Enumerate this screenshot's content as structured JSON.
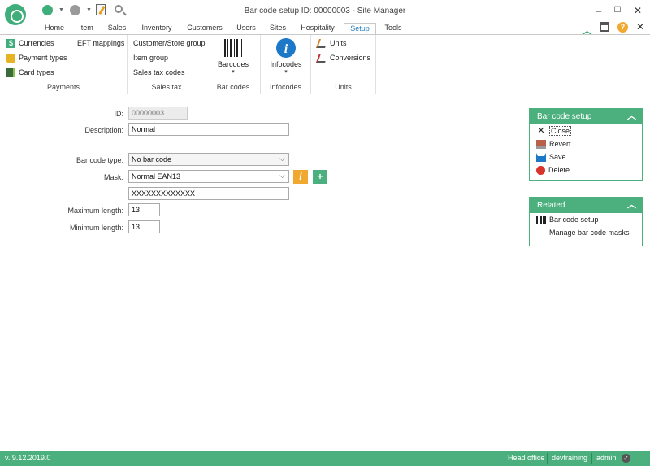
{
  "window": {
    "title": "Bar code setup ID: 00000003 - Site Manager",
    "minimize": "–",
    "maximize": "☐",
    "close": "✕"
  },
  "tabs": [
    {
      "label": "Home"
    },
    {
      "label": "Item"
    },
    {
      "label": "Sales"
    },
    {
      "label": "Inventory"
    },
    {
      "label": "Customers"
    },
    {
      "label": "Users"
    },
    {
      "label": "Sites"
    },
    {
      "label": "Hospitality"
    },
    {
      "label": "Setup",
      "active": true
    },
    {
      "label": "Tools"
    }
  ],
  "ribbon": {
    "payments": {
      "label": "Payments",
      "currencies": "Currencies",
      "payment_types": "Payment types",
      "card_types": "Card types",
      "eft_mappings": "EFT mappings"
    },
    "sales_tax": {
      "label": "Sales tax",
      "customer_store_group": "Customer/Store group",
      "item_group": "Item group",
      "sales_tax_codes": "Sales tax codes"
    },
    "bar_codes": {
      "label": "Bar codes",
      "barcodes": "Barcodes"
    },
    "infocodes": {
      "label": "Infocodes",
      "infocodes": "Infocodes"
    },
    "units": {
      "label": "Units",
      "units": "Units",
      "conversions": "Conversions"
    }
  },
  "form": {
    "id_label": "ID:",
    "id_value": "00000003",
    "description_label": "Description:",
    "description_value": "Normal",
    "bar_code_type_label": "Bar code type:",
    "bar_code_type_value": "No bar code",
    "mask_label": "Mask:",
    "mask_value": "Normal EAN13",
    "mask_pattern": "XXXXXXXXXXXXX",
    "max_length_label": "Maximum length:",
    "max_length_value": "13",
    "min_length_label": "Minimum length:",
    "min_length_value": "13"
  },
  "panel_actions": {
    "title": "Bar code setup",
    "close": "Close",
    "revert": "Revert",
    "save": "Save",
    "delete": "Delete"
  },
  "panel_related": {
    "title": "Related",
    "bar_code_setup": "Bar code setup",
    "manage_masks": "Manage bar code masks"
  },
  "status": {
    "version": "v. 9.12.2019.0",
    "site": "Head office",
    "database": "devtraining",
    "user": "admin"
  },
  "colors": {
    "accent": "#4cb07e",
    "tab_active_text": "#2a7fc0",
    "edit_button": "#f0a830",
    "add_button": "#4cb07e",
    "delete_icon": "#d9342b"
  }
}
